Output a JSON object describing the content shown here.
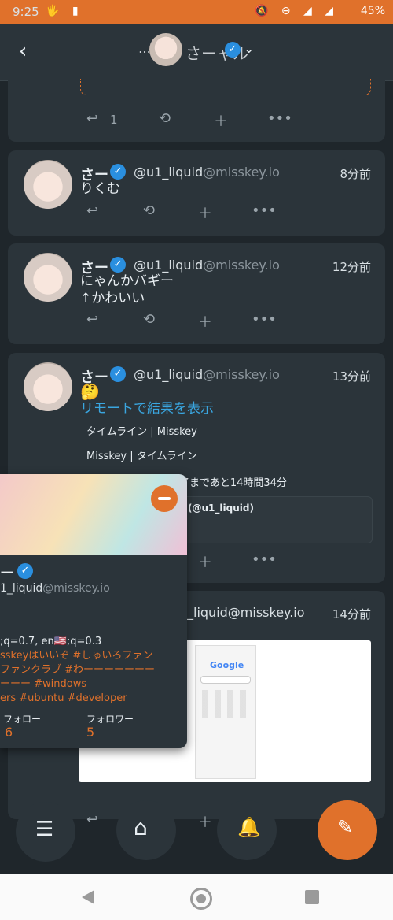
{
  "status_bar": {
    "time": "9:25",
    "battery": "45%"
  },
  "header": {
    "title": "さーャル"
  },
  "posts": [
    {
      "name": "さー",
      "username": "@u1_liquid",
      "host": "@misskey.io",
      "time": "8分前",
      "lines": [
        "りくむ"
      ]
    },
    {
      "name": "さー",
      "username": "@u1_liquid",
      "host": "@misskey.io",
      "time": "12分前",
      "lines": [
        "にゃんかバギー",
        "↑かわいい"
      ]
    },
    {
      "name": "さー",
      "username": "@u1_liquid",
      "host": "@misskey.io",
      "time": "13分前",
      "emoji": "🤔",
      "link": "リモートで結果を表示",
      "poll_options": [
        "タイムライン | Misskey",
        "Misskey | タイムライン"
      ],
      "poll_status": "了まであと14時間34分",
      "quote": "(@u1_liquid)"
    },
    {
      "username_tail": "_liquid@misskey.io",
      "time": "14分前"
    }
  ],
  "top_post": {
    "reply_count": "1"
  },
  "profile_popup": {
    "name": "ー",
    "username": "1_liquid",
    "host": "@misskey.io",
    "bio_line1": ";q=0.7, en🇺🇸;q=0.3",
    "bio_line2": "sskeyはいいぞ #しゅいろファン",
    "bio_line3": "ファンクラブ #わーーーーーーー",
    "bio_line4": "ーーー #windows",
    "bio_line5": "ers #ubuntu #developer",
    "following_label": "フォロー",
    "following_count": "6",
    "followers_label": "フォロワー",
    "followers_count": "5"
  },
  "embedded_screenshot": {
    "logo": "Google"
  },
  "icons": [
    "back-icon",
    "chevron-down-icon",
    "verified-icon",
    "reply-icon",
    "renote-icon",
    "plus-icon",
    "more-icon",
    "menu-icon",
    "home-icon",
    "bell-icon",
    "pencil-icon"
  ]
}
